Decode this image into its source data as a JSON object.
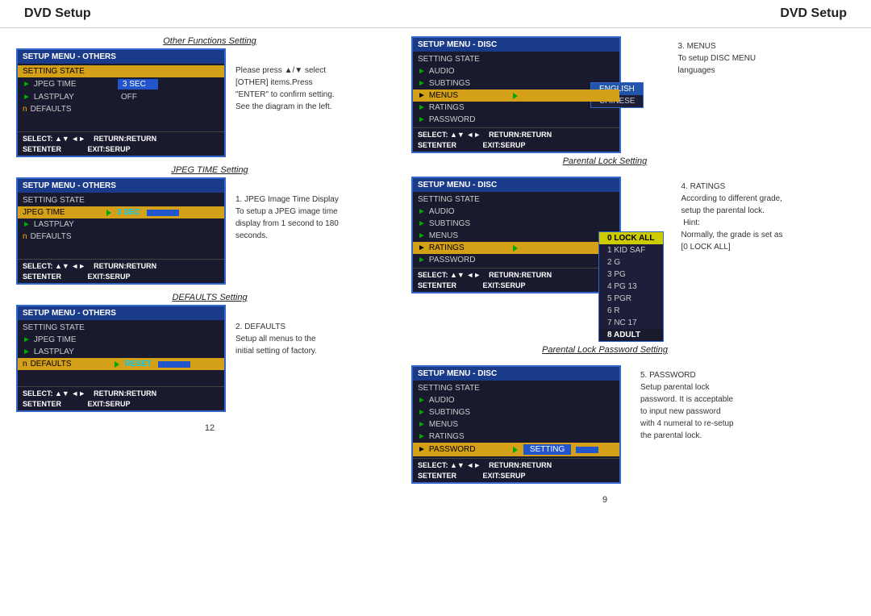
{
  "header": {
    "left_title": "DVD Setup",
    "right_title": "DVD Setup"
  },
  "left_page_num": "12",
  "right_page_num": "9",
  "sections": {
    "others_label": "Other Functions Setting",
    "jpeg_label": "JPEG TIME Setting",
    "defaults_label": "DEFAULTS Setting",
    "parental_lock_label": "Parental Lock Setting",
    "parental_password_label": "Parental Lock Password Setting"
  },
  "menus": {
    "others1": {
      "header": "SETUP MENU - OTHERS",
      "rows": [
        {
          "label": "SETTING STATE",
          "active": true
        },
        {
          "label": "JPEG TIME",
          "value": "3  SEC"
        },
        {
          "label": "LASTPLAY",
          "value": "OFF"
        },
        {
          "label": "DEFAULTS"
        }
      ],
      "footer_left": "SELECT: ▲▼ ◄►    RETURN:RETURN",
      "footer_right": "SET ENTER              EXIT:SERUP"
    },
    "others2": {
      "header": "SETUP MENU - OTHERS",
      "rows": [
        {
          "label": "SETTING STATE"
        },
        {
          "label": "JPEG TIME",
          "active": true,
          "value": "3  SEC"
        },
        {
          "label": "LASTPLAY"
        },
        {
          "label": "DEFAULTS"
        }
      ],
      "footer_left": "SELECT: ▲▼ ◄►    RETURN:RETURN",
      "footer_right": "SET ENTER              EXIT:SERUP"
    },
    "others3": {
      "header": "SETUP MENU - OTHERS",
      "rows": [
        {
          "label": "SETTING STATE"
        },
        {
          "label": "JPEG TIME"
        },
        {
          "label": "LASTPLAY"
        },
        {
          "label": "DEFAULTS",
          "active": true,
          "value": "RESET"
        }
      ],
      "footer_left": "SELECT: ▲▼ ◄►    RETURN:RETURN",
      "footer_right": "SET ENTER              EXIT:SERUP"
    },
    "disc1": {
      "header": "SETUP MENU - DISC",
      "rows": [
        {
          "label": "SETTING STATE"
        },
        {
          "label": "AUDIO"
        },
        {
          "label": "SUBTINGS"
        },
        {
          "label": "MENUS",
          "active": true
        },
        {
          "label": "RATINGS"
        },
        {
          "label": "PASSWORD"
        }
      ],
      "lang_items": [
        "ENGLISH",
        "CHINESE"
      ],
      "footer_left": "SELECT: ▲▼ ◄►    RETURN:RETURN",
      "footer_right": "SET ENTER              EXIT:SERUP"
    },
    "disc2": {
      "header": "SETUP MENU - DISC",
      "rows": [
        {
          "label": "SETTING STATE"
        },
        {
          "label": "AUDIO"
        },
        {
          "label": "SUBTINGS"
        },
        {
          "label": "MENUS"
        },
        {
          "label": "RATINGS",
          "active": true
        },
        {
          "label": "PASSWORD"
        }
      ],
      "rating_items": [
        "0 LOCK ALL",
        "1 KID SAF",
        "2 G",
        "3 PG",
        "4 PG 13",
        "5 PGR",
        "6 R",
        "7 NC 17",
        "8 ADULT"
      ],
      "footer_left": "SELECT: ▲▼ ◄►    RETURN:RETURN",
      "footer_right": "SET ENTER              EXIT:SERUP"
    },
    "disc3": {
      "header": "SETUP MENU - DISC",
      "rows": [
        {
          "label": "SETTING STATE"
        },
        {
          "label": "AUDIO"
        },
        {
          "label": "SUBTINGS"
        },
        {
          "label": "MENUS"
        },
        {
          "label": "RATINGS"
        },
        {
          "label": "PASSWORD",
          "active": true,
          "value": "SETTING"
        }
      ],
      "footer_left": "SELECT: ▲▼ ◄►    RETURN:RETURN",
      "footer_right": "SET ENTER              EXIT:SERUP"
    }
  },
  "descriptions": {
    "others1": "Please press ▲/▼ select\n[OTHER] items.Press\n\"ENTER\" to confirm setting.\nSee the diagram in the left.",
    "jpeg": "1. JPEG Image Time Display\nTo setup a JPEG image time\ndisplay from 1 second to 180\nseconds.",
    "defaults": "2. DEFAULTS\nSetup all menus to the\ninitial setting of factory.",
    "menus": "3. MENUS\nTo setup DISC MENU\nlanguages",
    "ratings": "4. RATINGS\nAccording to different grade,\nsetup the parental lock.\n Hint:\nNormally, the grade is set as\n[0 LOCK ALL]",
    "password": "5. PASSWORD\nSetup parental lock\npassword. It is acceptable\nto input new password\nwith 4 numeral to re-setup\nthe parental lock."
  }
}
